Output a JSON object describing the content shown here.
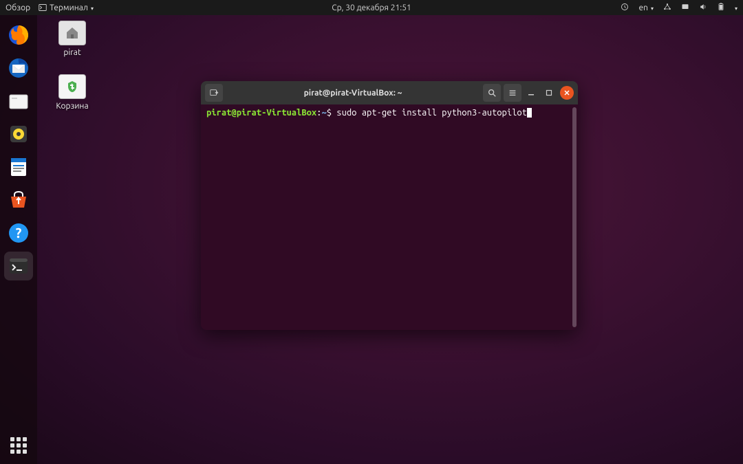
{
  "topbar": {
    "activities": "Обзор",
    "app_indicator": "Терминал",
    "datetime": "Ср, 30 декабря  21:51",
    "lang": "en"
  },
  "desktop": {
    "home_label": "pirat",
    "trash_label": "Корзина"
  },
  "dock": {
    "items": [
      {
        "name": "firefox"
      },
      {
        "name": "thunderbird"
      },
      {
        "name": "files"
      },
      {
        "name": "rhythmbox"
      },
      {
        "name": "libreoffice-writer"
      },
      {
        "name": "ubuntu-software"
      },
      {
        "name": "help"
      },
      {
        "name": "terminal"
      }
    ]
  },
  "terminal": {
    "title": "pirat@pirat-VirtualBox: ~",
    "prompt": {
      "user": "pirat",
      "at": "@",
      "host": "pirat-VirtualBox",
      "colon": ":",
      "path": "~",
      "symbol": "$"
    },
    "command": "sudo apt-get install python3-autopilot"
  }
}
